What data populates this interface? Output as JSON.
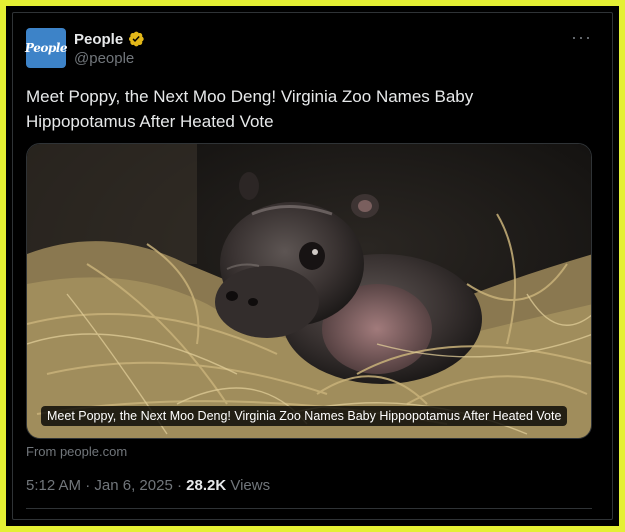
{
  "author": {
    "avatar_text": "People",
    "display_name": "People",
    "handle": "@people",
    "verified_icon": "verified-badge-gold",
    "verified_color": "#e2b719"
  },
  "post": {
    "text": "Meet Poppy, the Next Moo Deng! Virginia Zoo Names Baby Hippopotamus After Heated Vote",
    "media_caption": "Meet Poppy, the Next Moo Deng! Virginia Zoo Names Baby Hippopotamus After Heated Vote",
    "media_alt": "Baby pygmy hippopotamus nestled in hay",
    "source": "From people.com",
    "time": "5:12 AM",
    "date": "Jan 6, 2025",
    "separator": "·",
    "views_count": "28.2K",
    "views_label": "Views"
  },
  "ui": {
    "more_icon": "more-horizontal-icon",
    "frame_color": "#e4f034"
  }
}
